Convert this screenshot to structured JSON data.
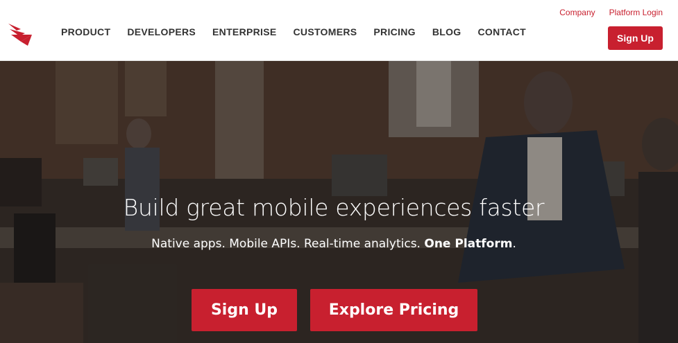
{
  "header": {
    "logo_icon": "bird-logo-icon",
    "nav": [
      {
        "label": "PRODUCT"
      },
      {
        "label": "DEVELOPERS"
      },
      {
        "label": "ENTERPRISE"
      },
      {
        "label": "CUSTOMERS"
      },
      {
        "label": "PRICING"
      },
      {
        "label": "BLOG"
      },
      {
        "label": "CONTACT"
      }
    ],
    "utility_links": [
      {
        "label": "Company"
      },
      {
        "label": "Platform Login"
      }
    ],
    "signup_label": "Sign Up"
  },
  "hero": {
    "title": "Build great mobile experiences faster",
    "subtitle_plain": "Native apps. Mobile APIs. Real-time analytics. ",
    "subtitle_bold": "One Platform",
    "subtitle_end": ".",
    "cta_signup": "Sign Up",
    "cta_pricing": "Explore Pricing"
  },
  "colors": {
    "accent": "#c8202f",
    "nav_text": "#333333",
    "header_bg": "#ffffff"
  }
}
